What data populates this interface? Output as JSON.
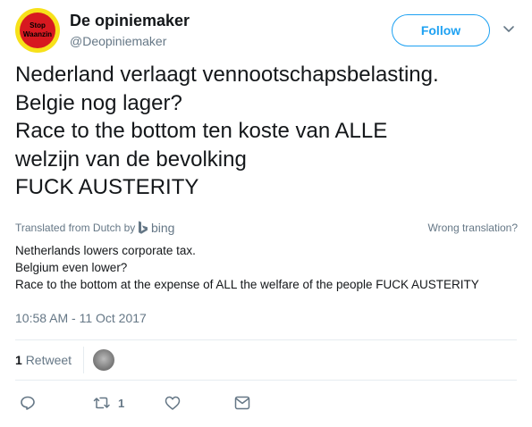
{
  "user": {
    "name": "De opiniemaker",
    "handle": "@Deopiniemaker",
    "avatar_text_line1": "Stop",
    "avatar_text_line2": "Waanzin"
  },
  "follow_label": "Follow",
  "tweet_text": "Nederland verlaagt vennootschapsbelasting.\nBelgie nog lager?\nRace to the bottom ten koste van ALLE\nwelzijn van de bevolking\nFUCK AUSTERITY",
  "translation": {
    "translated_from": "Translated from Dutch by",
    "provider": "bing",
    "wrong_translation": "Wrong translation?",
    "text": "Netherlands lowers corporate tax.\nBelgium even lower?\nRace to the bottom at the expense of ALL the welfare of the people FUCK AUSTERITY"
  },
  "timestamp": "10:58 AM - 11 Oct 2017",
  "stats": {
    "retweet_count": "1",
    "retweet_label": "Retweet"
  },
  "actions": {
    "retweet_count": "1"
  },
  "colors": {
    "accent": "#1da1f2",
    "secondary_text": "#657786",
    "divider": "#e6ecf0"
  },
  "icons": [
    "chevron-down-icon",
    "bing-logo-icon",
    "reply-icon",
    "retweet-icon",
    "like-icon",
    "direct-message-icon"
  ]
}
